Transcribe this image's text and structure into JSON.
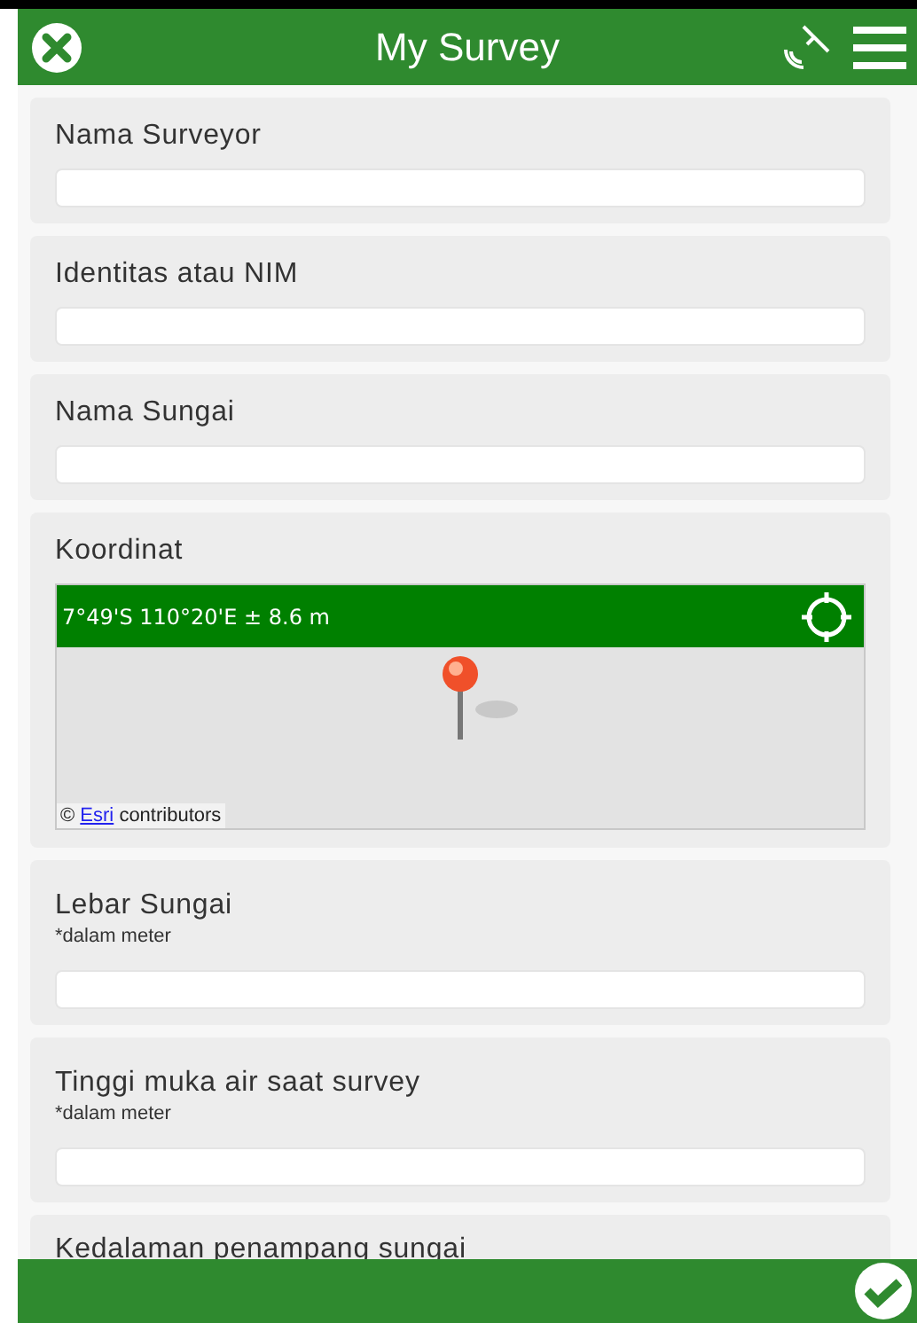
{
  "header": {
    "title": "My Survey"
  },
  "questions": [
    {
      "kind": "text",
      "label": "Nama Surveyor"
    },
    {
      "kind": "text",
      "label": "Identitas atau NIM"
    },
    {
      "kind": "text",
      "label": "Nama Sungai"
    },
    {
      "kind": "map",
      "label": "Koordinat",
      "coordinates": "7°49'S 110°20'E ± 8.6 m",
      "attribution_prefix": "©",
      "attribution_link": "Esri",
      "attribution_suffix": "contributors"
    },
    {
      "kind": "text",
      "label": "Lebar Sungai",
      "hint": "*dalam meter"
    },
    {
      "kind": "text",
      "label": "Tinggi muka air saat survey",
      "hint": "*dalam meter"
    },
    {
      "kind": "cut",
      "label": "Kedalaman penampang sungai"
    }
  ]
}
